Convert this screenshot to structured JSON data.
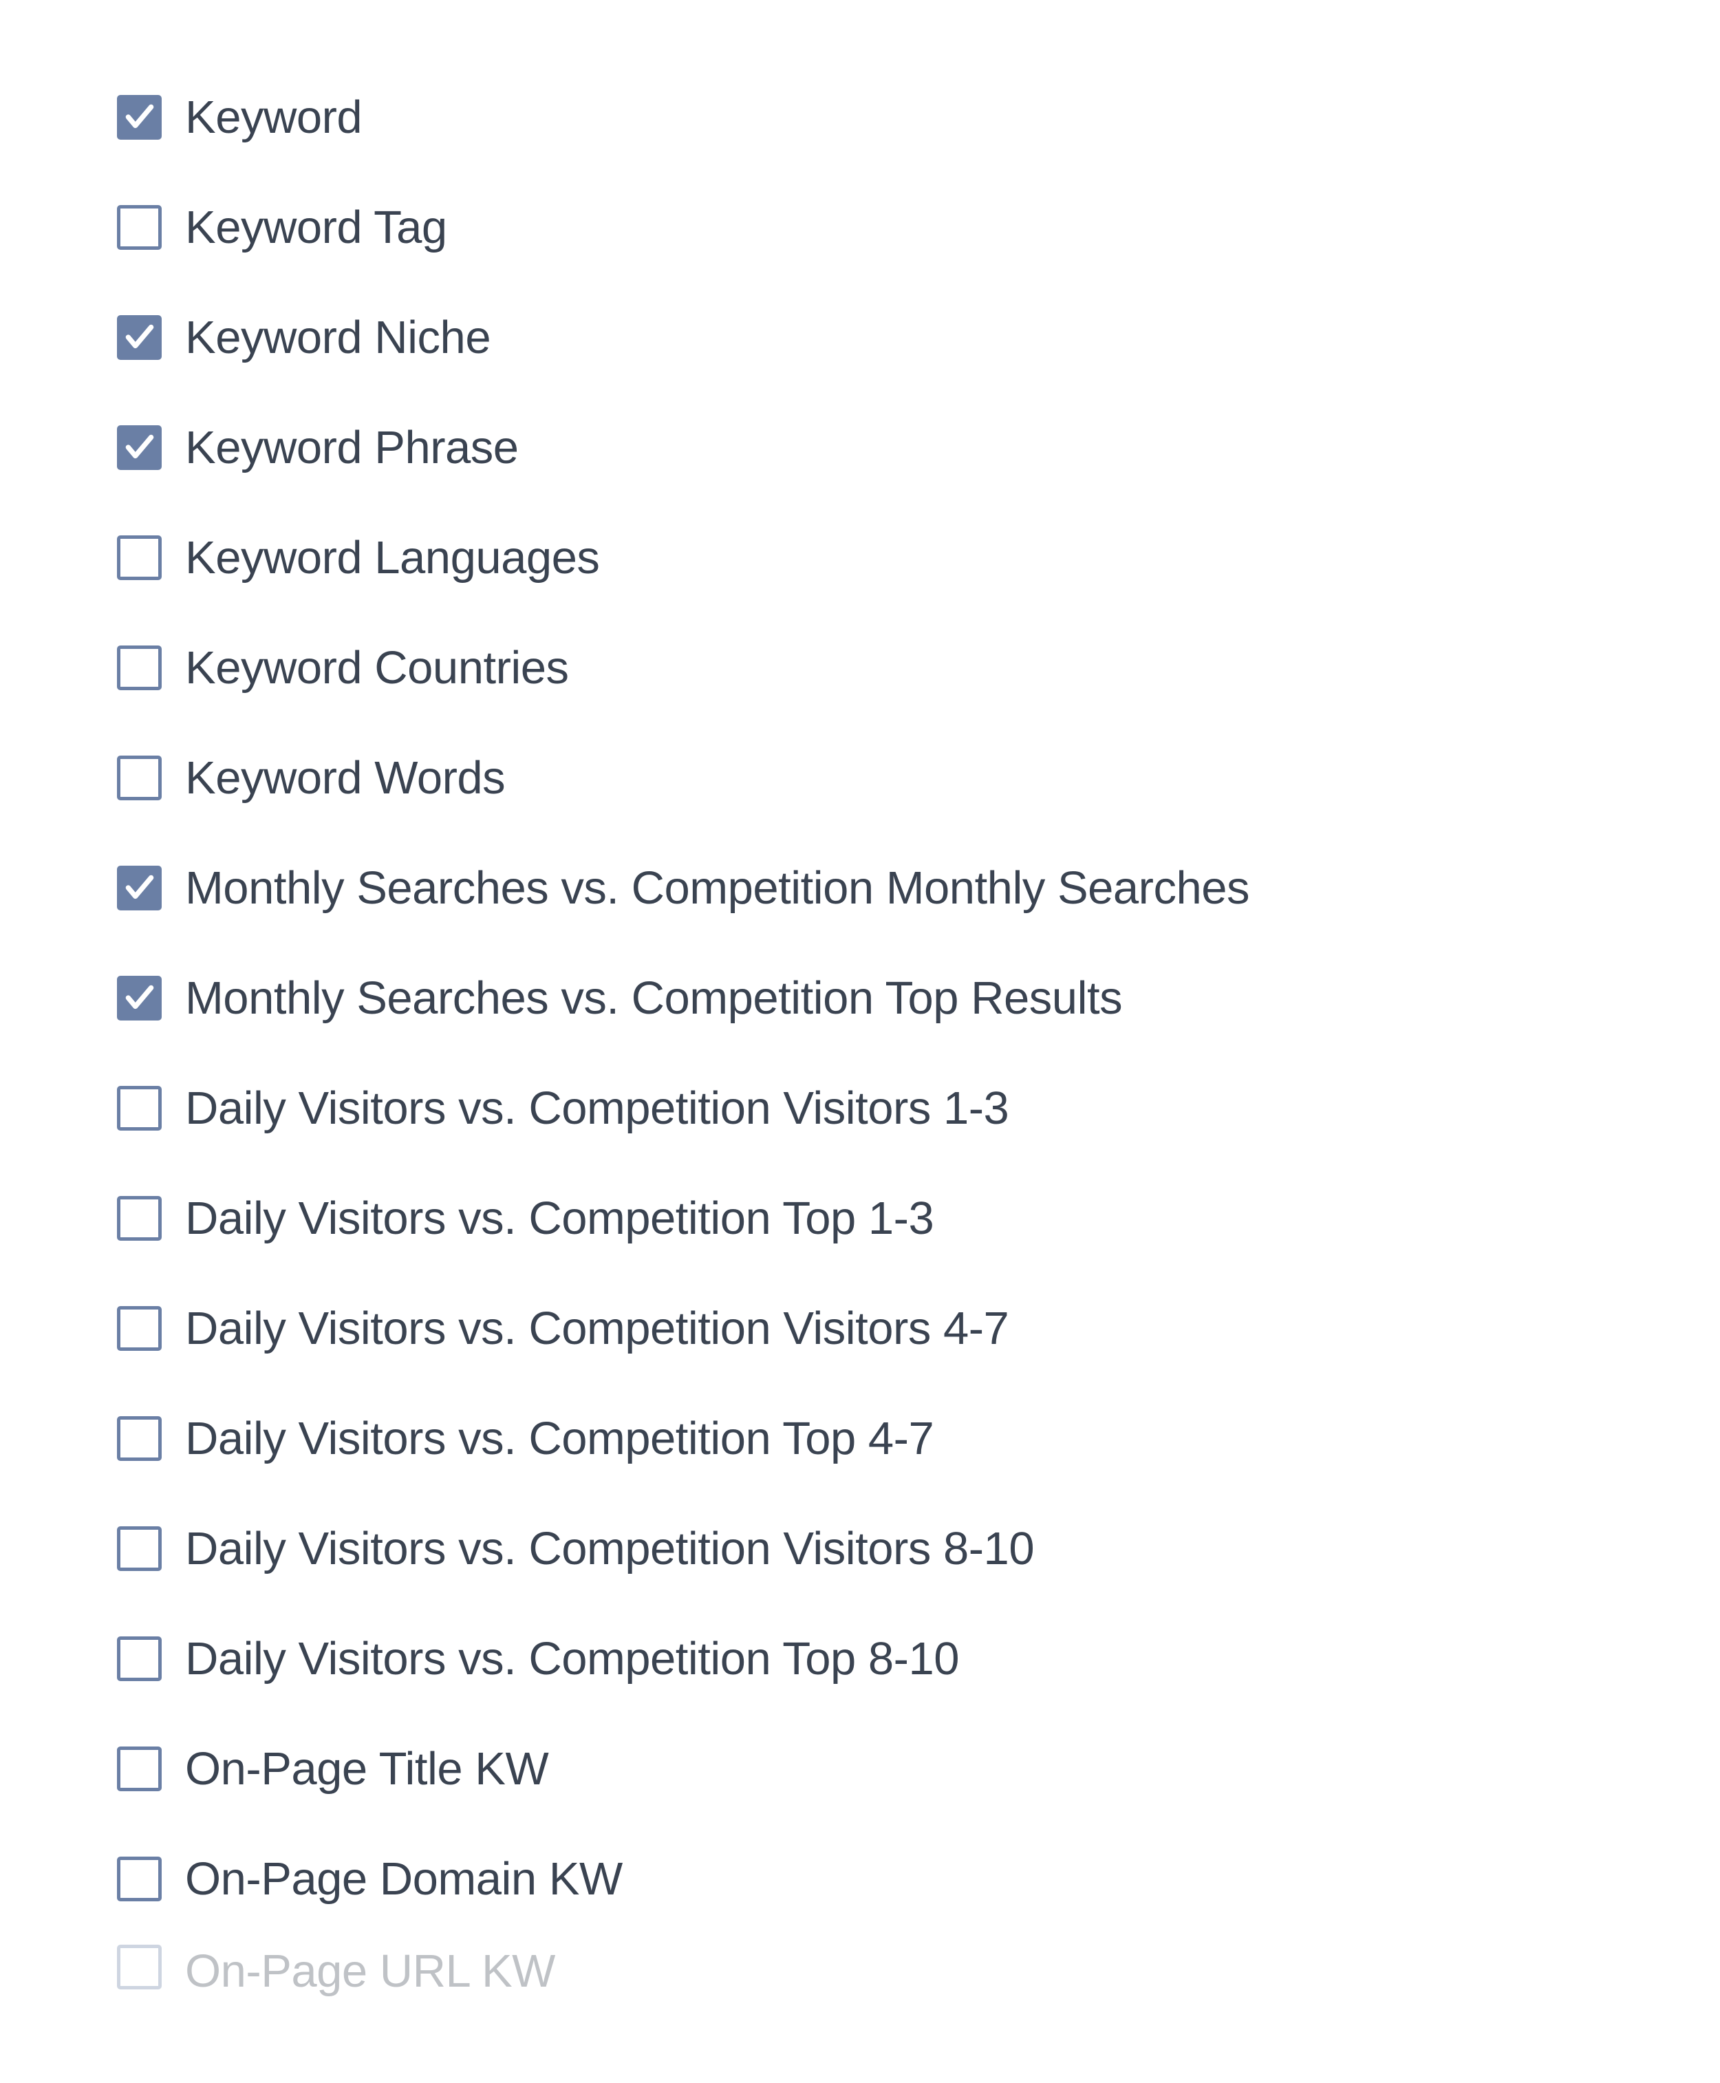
{
  "options": [
    {
      "label": "Keyword",
      "checked": true,
      "faded": false
    },
    {
      "label": "Keyword Tag",
      "checked": false,
      "faded": false
    },
    {
      "label": "Keyword Niche",
      "checked": true,
      "faded": false
    },
    {
      "label": "Keyword Phrase",
      "checked": true,
      "faded": false
    },
    {
      "label": "Keyword Languages",
      "checked": false,
      "faded": false
    },
    {
      "label": "Keyword Countries",
      "checked": false,
      "faded": false
    },
    {
      "label": "Keyword Words",
      "checked": false,
      "faded": false
    },
    {
      "label": "Monthly Searches vs. Competition Monthly Searches",
      "checked": true,
      "faded": false
    },
    {
      "label": "Monthly Searches vs. Competition Top Results",
      "checked": true,
      "faded": false
    },
    {
      "label": "Daily Visitors vs. Competition Visitors 1-3",
      "checked": false,
      "faded": false
    },
    {
      "label": "Daily Visitors vs. Competition Top 1-3",
      "checked": false,
      "faded": false
    },
    {
      "label": "Daily Visitors vs. Competition Visitors 4-7",
      "checked": false,
      "faded": false
    },
    {
      "label": "Daily Visitors vs. Competition Top 4-7",
      "checked": false,
      "faded": false
    },
    {
      "label": "Daily Visitors vs. Competition Visitors 8-10",
      "checked": false,
      "faded": false
    },
    {
      "label": "Daily Visitors vs. Competition Top 8-10",
      "checked": false,
      "faded": false
    },
    {
      "label": "On-Page Title KW",
      "checked": false,
      "faded": false
    },
    {
      "label": "On-Page Domain KW",
      "checked": false,
      "faded": false
    },
    {
      "label": "On-Page URL KW",
      "checked": false,
      "faded": true
    }
  ]
}
